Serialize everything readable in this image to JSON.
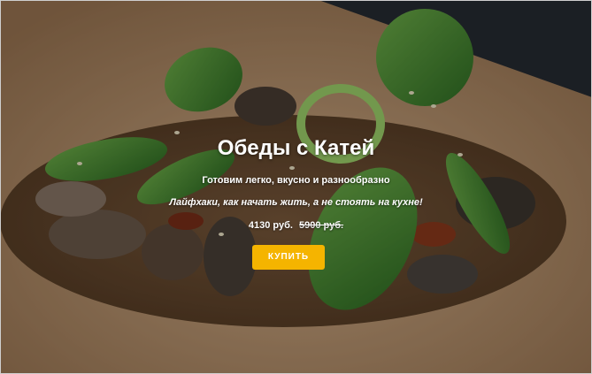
{
  "hero": {
    "title": "Обеды с Катей",
    "subtitle": "Готовим легко, вкусно и разнообразно",
    "tagline": "Лайфхаки, как начать жить, а не стоять на кухне!",
    "price_current": "4130 руб.",
    "price_old": "5900 руб.",
    "button_label": "КУПИТЬ"
  },
  "colors": {
    "button": "#f5b400",
    "background_dark": "#2a2f36",
    "board": "#c9a37a"
  }
}
